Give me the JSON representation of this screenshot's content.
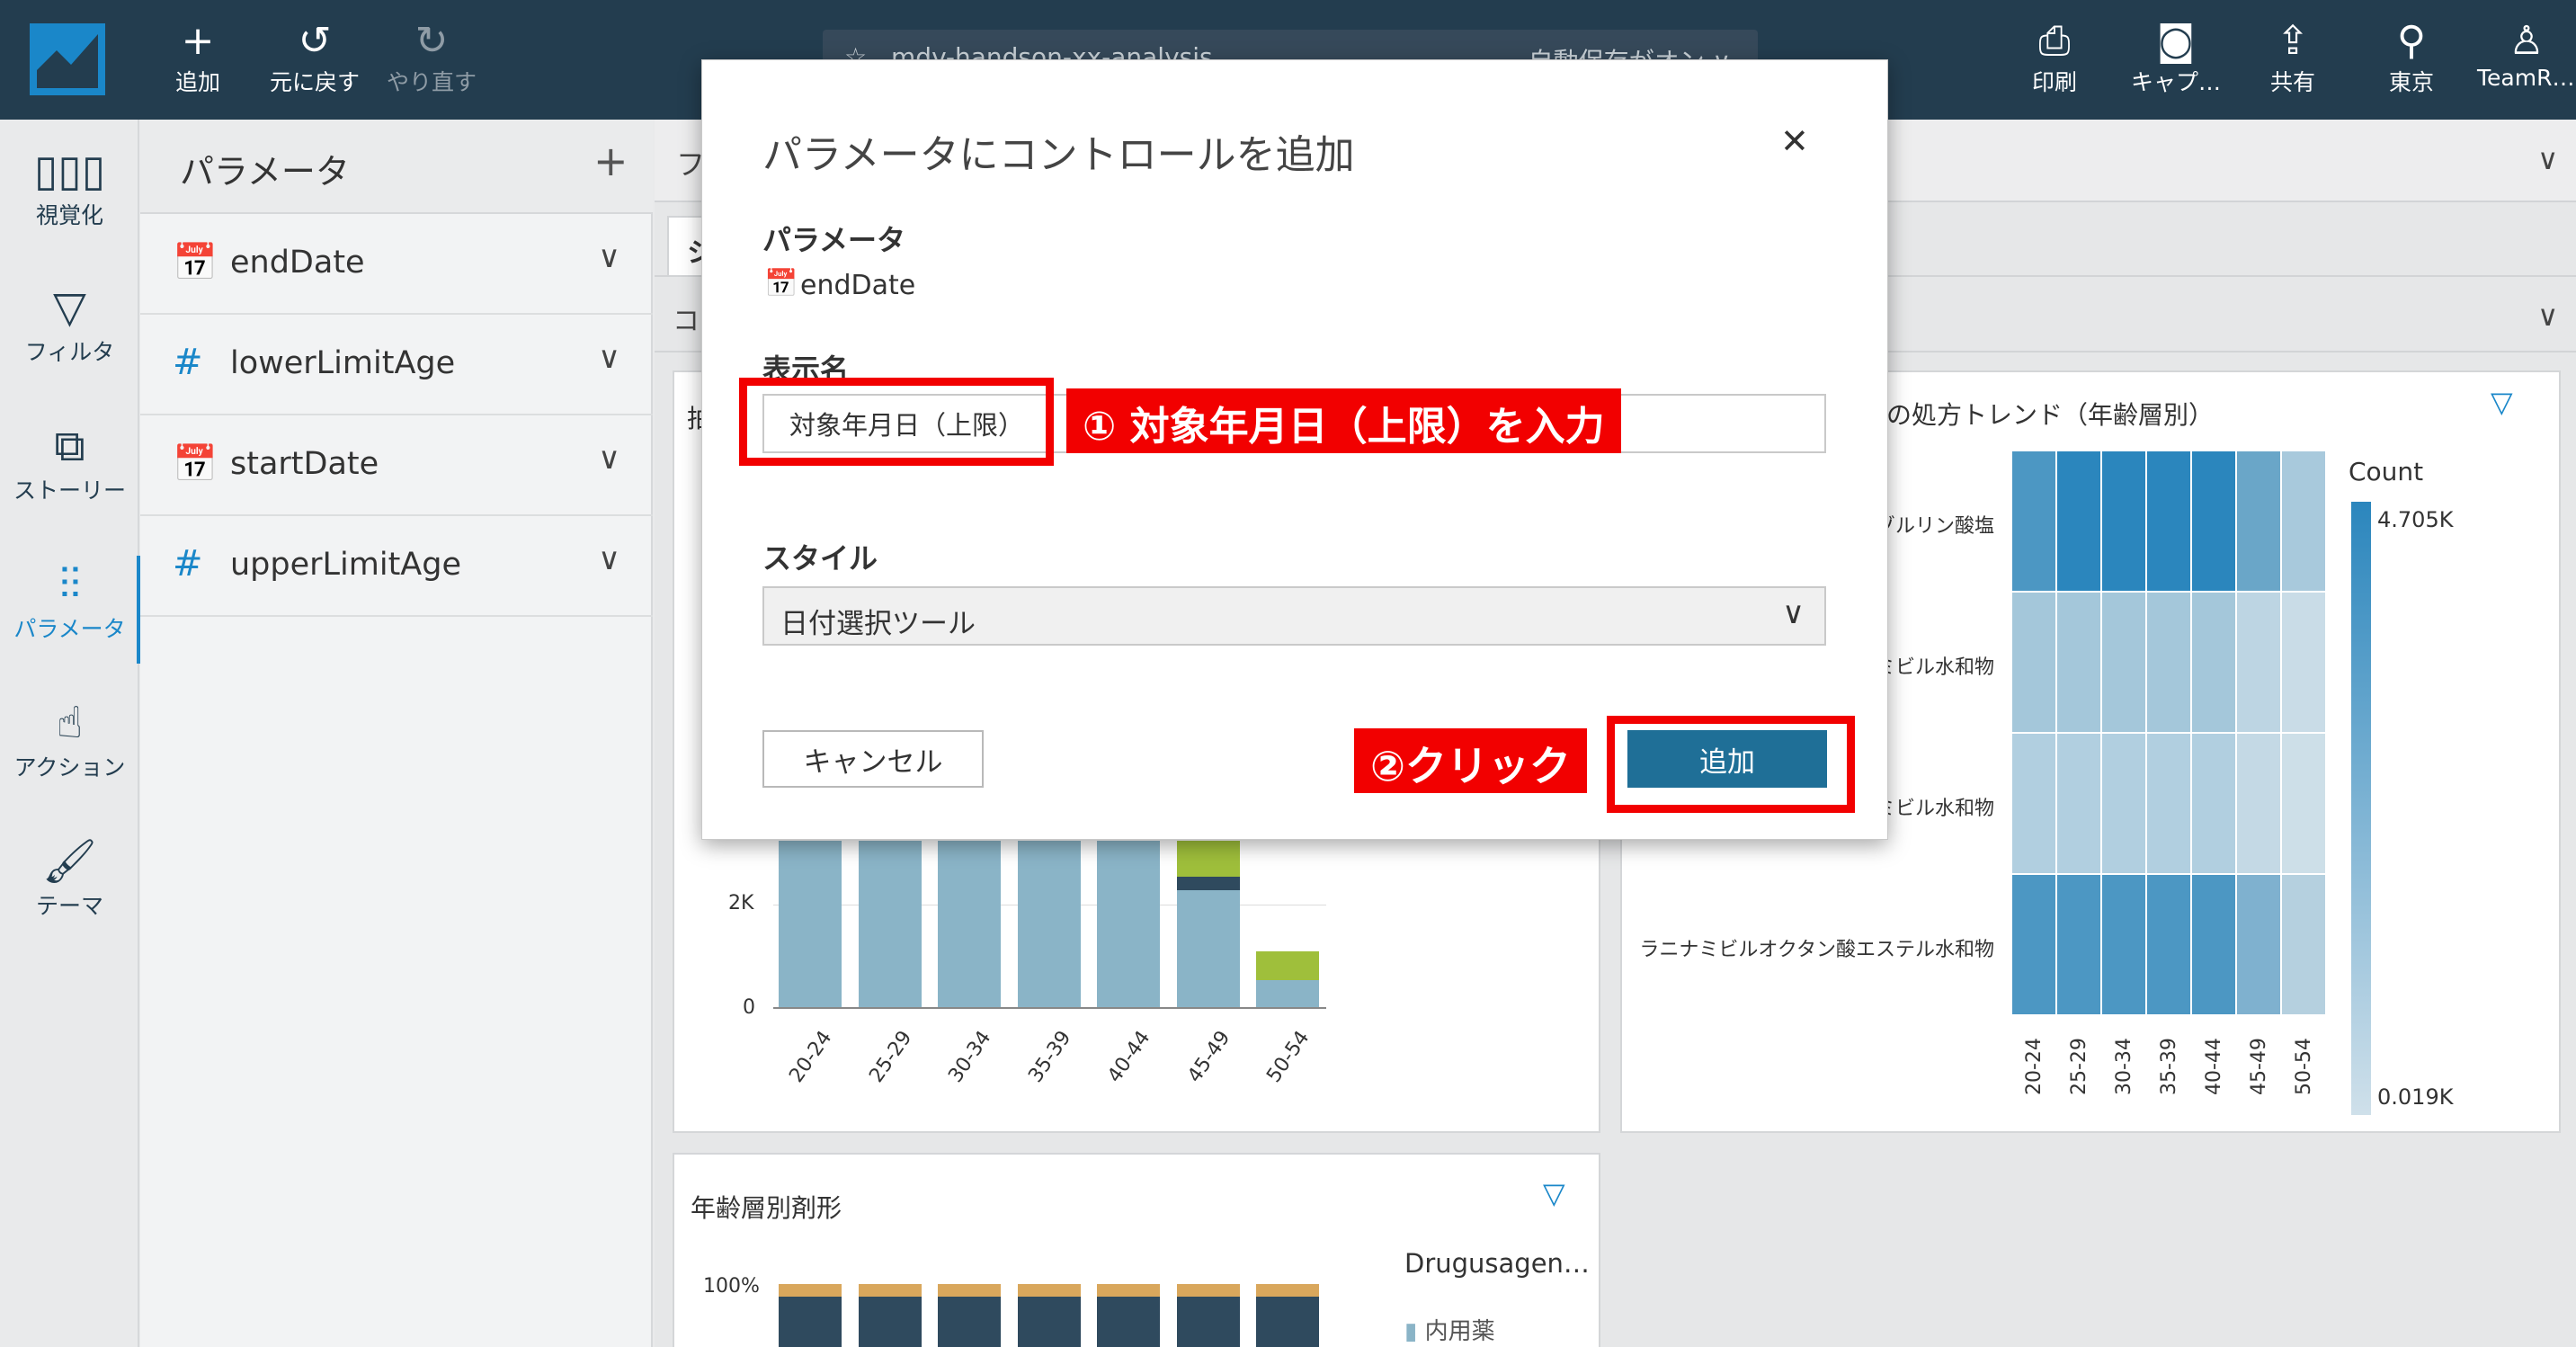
{
  "topbar": {
    "add": "追加",
    "undo": "元に戻す",
    "redo": "やり直す",
    "analysis_name": "mdv-handson-xx-analysis",
    "autosave": "自動保存がオン ∨",
    "print": "印刷",
    "capture": "キャプ…",
    "share": "共有",
    "region": "東京",
    "user": "TeamR…"
  },
  "rail": {
    "visualize": "視覚化",
    "filter": "フィルタ",
    "story": "ストーリー",
    "parameter": "パラメータ",
    "action": "アクション",
    "theme": "テーマ"
  },
  "params_panel": {
    "title": "パラメータ",
    "items": [
      {
        "name": "endDate",
        "type": "date"
      },
      {
        "name": "lowerLimitAge",
        "type": "number"
      },
      {
        "name": "startDate",
        "type": "date"
      },
      {
        "name": "upperLimitAge",
        "type": "number"
      }
    ]
  },
  "workspace": {
    "tab_fragment": "フ",
    "sheet_fragment": "シ",
    "control_fragment": "コ",
    "card_fragment": "拍",
    "heatmap_title": "の処方トレンド（年齢層別）",
    "heatmap_rows": [
      "ゾルリン酸塩",
      "ミビル水和物",
      "ミビル水和物",
      "ラニナミビルオクタン酸エステル水和物"
    ],
    "heatmap_cols": [
      "20-24",
      "25-29",
      "30-34",
      "35-39",
      "40-44",
      "45-49",
      "50-54"
    ],
    "legend_title": "Count",
    "legend_max": "4.705K",
    "legend_min": "0.019K",
    "bar_y_ticks": [
      "2K",
      "0"
    ],
    "bar_x": [
      "20-24",
      "25-29",
      "30-34",
      "35-39",
      "40-44",
      "45-49",
      "50-54"
    ],
    "bottom_card_title": "年齢層別剤形",
    "bottom_y_tick": "100%",
    "bottom_legend_title": "Drugusagen…",
    "bottom_legend_item": "内用薬"
  },
  "modal": {
    "title": "パラメータにコントロールを追加",
    "param_label": "パラメータ",
    "param_value": "endDate",
    "display_name_label": "表示名",
    "display_name_value": "対象年月日（上限）",
    "style_label": "スタイル",
    "style_value": "日付選択ツール",
    "cancel": "キャンセル",
    "add": "追加"
  },
  "annotations": {
    "step1": "① 対象年月日（上限）を入力",
    "step2": "②クリック"
  },
  "colors": {
    "topbar": "#233d4f",
    "accent": "#1a87c9",
    "primary_button": "#1f6f97",
    "annotation_red": "#f20000",
    "bar_blue": "#8ab4c7",
    "bar_dark": "#2f4a5e",
    "bar_green": "#9fbf3b",
    "bar_orange": "#d9a75c"
  }
}
